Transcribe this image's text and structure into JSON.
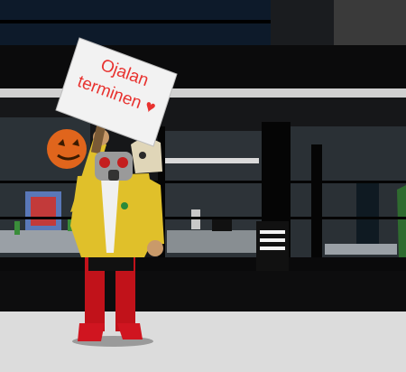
{
  "sign": {
    "line1": "Ojalan",
    "line2": "terminen",
    "heart": "♥"
  },
  "colors": {
    "sign_board": "#f2f2f2",
    "sign_text": "#e8322f",
    "jacket": "#e0c02a",
    "legs": "#c1121a",
    "pumpkin": "#e0651c",
    "floor": "#dcdcdc",
    "wall": "#151618"
  }
}
